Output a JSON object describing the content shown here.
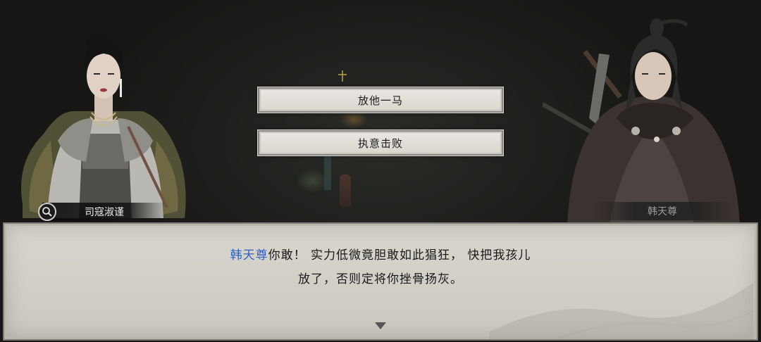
{
  "choices": [
    {
      "label": "放他一马"
    },
    {
      "label": "执意击败"
    }
  ],
  "characters": {
    "left": {
      "name": "司寇淑谨"
    },
    "right": {
      "name": "韩天尊"
    }
  },
  "dialog": {
    "speaker": "韩天尊",
    "line1_rest": "你敢！ 实力低微竟胆敢如此猖狂， 快把我孩儿",
    "line2": "放了，否则定将你挫骨扬灰。"
  },
  "colors": {
    "speaker_name": "#2d5fc4",
    "dialog_bg": "#d9d6ce",
    "choice_bg": "#e9e7e1"
  },
  "icons": {
    "search": "search-icon",
    "advance": "advance-arrow-icon"
  }
}
